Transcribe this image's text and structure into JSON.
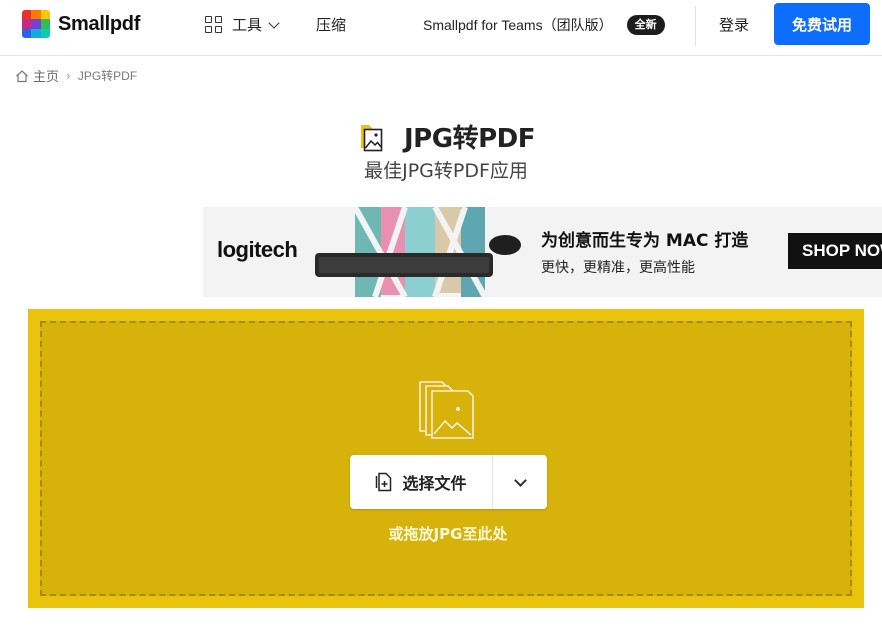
{
  "header": {
    "logo_text": "Smallpdf",
    "nav_tools_label": "工具",
    "nav_compress_label": "压缩",
    "nav_teams_label": "Smallpdf for Teams（团队版）",
    "badge_new": "全新",
    "login_label": "登录",
    "trial_label": "免费试用",
    "brand_color": "#0d6efd"
  },
  "breadcrumb": {
    "home_label": "主页",
    "separator": "›",
    "current_label": "JPG转PDF"
  },
  "page": {
    "title": "JPG转PDF",
    "subtitle": "最佳JPG转PDF应用",
    "accent_color": "#eac40c"
  },
  "ad": {
    "brand": "logitech",
    "headline": "为创意而生专为 MAC 打造",
    "subline": "更快，更精准，更高性能",
    "cta": "SHOP NOW"
  },
  "dropzone": {
    "choose_label": "选择文件",
    "hint": "或拖放JPG至此处",
    "background_color": "#d6b20a"
  },
  "icons": {
    "grid": "grid-icon",
    "chevron": "chevron-down-icon",
    "home": "home-icon",
    "title": "image-file-icon",
    "files": "image-files-icon",
    "file_add": "file-add-icon"
  }
}
